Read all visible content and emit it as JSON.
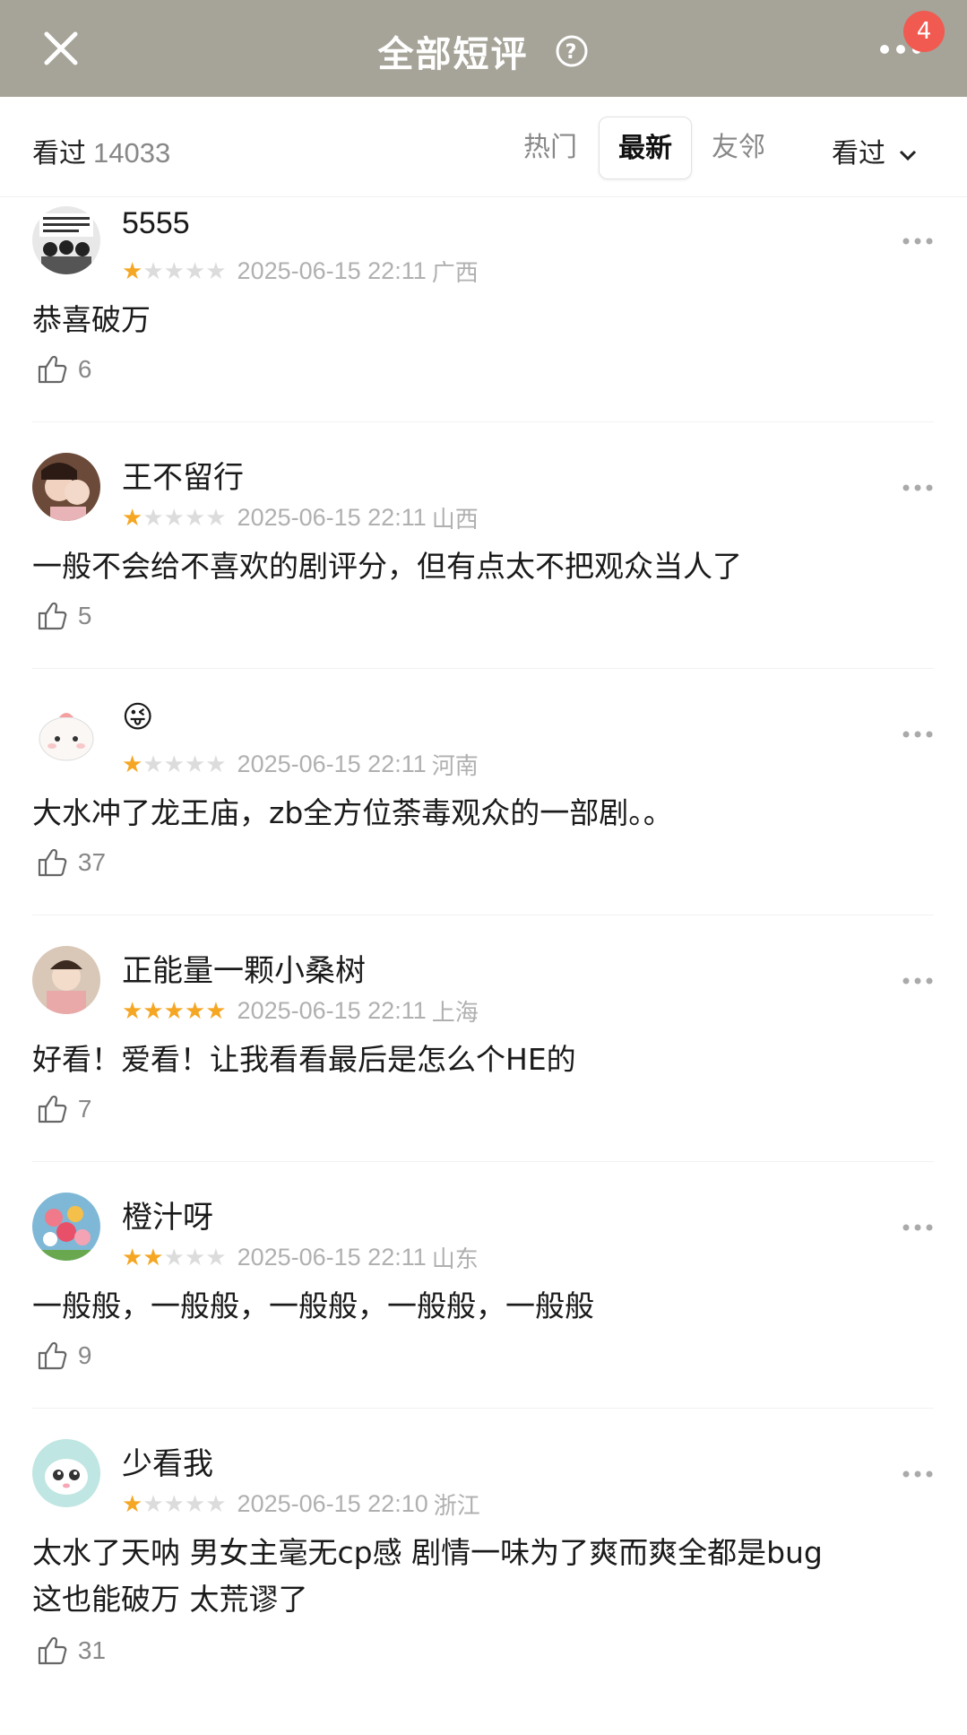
{
  "header": {
    "title": "全部短评",
    "notification_count": "4"
  },
  "filter": {
    "watched_label": "看过",
    "watched_count": "14033",
    "tabs": [
      {
        "label": "热门",
        "active": false
      },
      {
        "label": "最新",
        "active": true
      },
      {
        "label": "友邻",
        "active": false
      }
    ],
    "sort_label": "看过"
  },
  "comments": [
    {
      "user": "5555",
      "rating": 1,
      "date": "2025-06-15 22:11",
      "region": "广西",
      "text": "恭喜破万",
      "likes": "6"
    },
    {
      "user": "王不留行",
      "rating": 1,
      "date": "2025-06-15 22:11",
      "region": "山西",
      "text": "一般不会给不喜欢的剧评分，但有点太不把观众当人了",
      "likes": "5"
    },
    {
      "user": "😜",
      "rating": 1,
      "date": "2025-06-15 22:11",
      "region": "河南",
      "text": "大水冲了龙王庙，zb全方位荼毒观众的一部剧。。",
      "likes": "37"
    },
    {
      "user": "正能量一颗小桑树",
      "rating": 5,
      "date": "2025-06-15 22:11",
      "region": "上海",
      "text": "好看！爱看！让我看看最后是怎么个HE的",
      "likes": "7"
    },
    {
      "user": "橙汁呀",
      "rating": 2,
      "date": "2025-06-15 22:11",
      "region": "山东",
      "text": "一般般，一般般，一般般，一般般，一般般",
      "likes": "9"
    },
    {
      "user": "少看我",
      "rating": 1,
      "date": "2025-06-15 22:10",
      "region": "浙江",
      "text": "太水了天呐 男女主毫无cp感 剧情一味为了爽而爽全都是bug",
      "text2": "这也能破万 太荒谬了",
      "likes": "31"
    }
  ],
  "colors": {
    "header_bg": "#a6a398",
    "star_active": "#f5a623",
    "badge": "#f15a50"
  }
}
